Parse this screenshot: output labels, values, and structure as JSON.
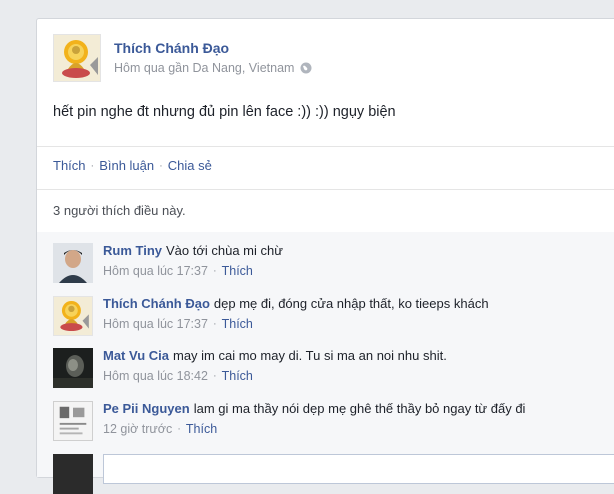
{
  "post": {
    "author": "Thích Chánh Đạo",
    "meta": "Hôm qua gần Da Nang, Vietnam",
    "text": "hết pin nghe đt nhưng đủ pin lên face :)) :)) ngụy biện"
  },
  "actions": {
    "like": "Thích",
    "comment": "Bình luận",
    "share": "Chia sẻ"
  },
  "likes_text": "3 người thích điều này.",
  "comments": [
    {
      "name": "Rum Tiny",
      "text": "Vào tới chùa mi chừ",
      "time": "Hôm qua lúc 17:37",
      "like": "Thích"
    },
    {
      "name": "Thích Chánh Đạo",
      "text": "dẹp mẹ đi, đóng cửa nhập thất, ko tieeps khách",
      "time": "Hôm qua lúc 17:37",
      "like": "Thích"
    },
    {
      "name": "Mat Vu Cia",
      "text": "may im cai mo may di. Tu si ma an noi nhu shit.",
      "time": "Hôm qua lúc 18:42",
      "like": "Thích"
    },
    {
      "name": "Pe Pii Nguyen",
      "text": "lam gi ma thầy nói dẹp mẹ ghê thế thầy bỏ ngay từ đấy đi",
      "time": "12 giờ trước",
      "like": "Thích"
    }
  ],
  "colors": {
    "link": "#3b5998",
    "text": "#1d2129",
    "muted": "#90949c"
  }
}
